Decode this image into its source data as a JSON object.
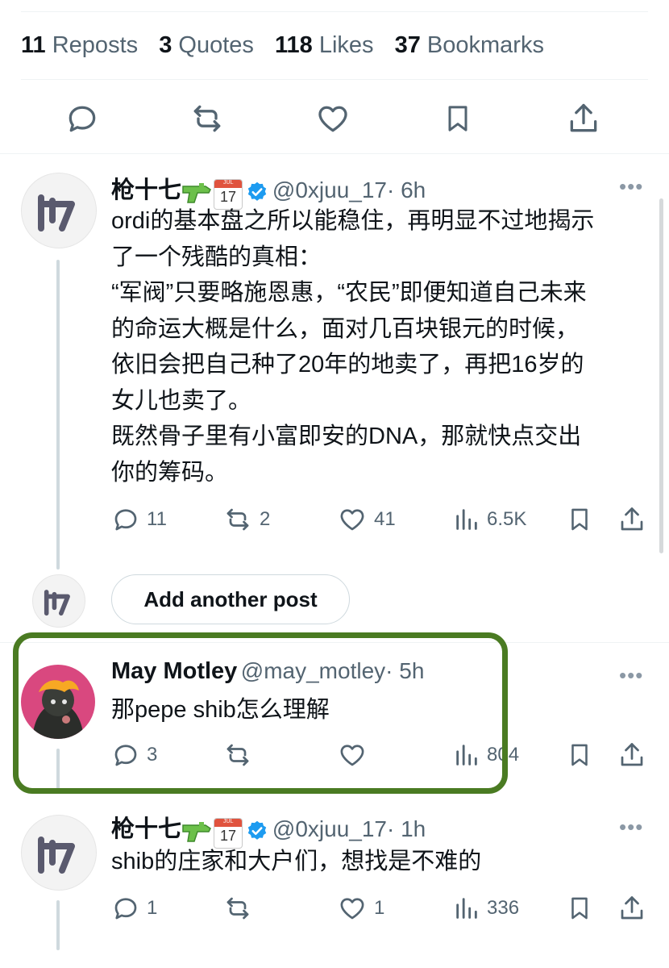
{
  "stats": {
    "reposts_count": "11",
    "reposts_label": "Reposts",
    "quotes_count": "3",
    "quotes_label": "Quotes",
    "likes_count": "118",
    "likes_label": "Likes",
    "bookmarks_count": "37",
    "bookmarks_label": "Bookmarks"
  },
  "main_actions": [
    "reply-icon",
    "repost-icon",
    "like-icon",
    "bookmark-icon",
    "share-icon"
  ],
  "post1": {
    "name": "枪十七",
    "handle": "@0xjuu_17",
    "time": "· 6h",
    "lines": [
      "ordi的基本盘之所以能稳住，再明显不过地揭示",
      "了一个残酷的真相：",
      "“军阀”只要略施恩惠，“农民”即便知道自己未来",
      "的命运大概是什么，面对几百块银元的时候，",
      "依旧会把自己种了20年的地卖了，再把16岁的",
      "女儿也卖了。",
      "既然骨子里有小富即安的DNA，那就快点交出",
      "你的筹码。"
    ],
    "replies": "11",
    "reposts": "2",
    "likes": "41",
    "views": "6.5K",
    "more": "•••",
    "calendar_month": "JUL",
    "calendar_day": "17"
  },
  "add_post": {
    "label": "Add another post"
  },
  "post2": {
    "name": "May Motley",
    "handle": "@may_motley",
    "time": "· 5h",
    "text": "那pepe shib怎么理解",
    "replies": "3",
    "views": "804",
    "more": "•••"
  },
  "post3": {
    "name": "枪十七",
    "handle": "@0xjuu_17",
    "time": "· 1h",
    "text": "shib的庄家和大户们，想找是不难的",
    "replies": "1",
    "likes": "1",
    "views": "336",
    "more": "•••",
    "calendar_month": "JUL",
    "calendar_day": "17"
  },
  "colors": {
    "verified": "#1d9bf0",
    "highlight": "#4a7b22",
    "muted": "#536471"
  }
}
